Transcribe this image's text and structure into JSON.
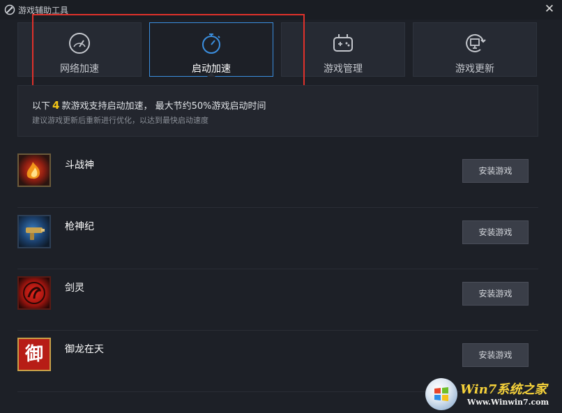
{
  "window": {
    "title": "游戏辅助工具",
    "close_glyph": "✕"
  },
  "tabs": [
    {
      "label": "网络加速",
      "icon": "speedometer-icon",
      "active": false
    },
    {
      "label": "启动加速",
      "icon": "stopwatch-icon",
      "active": true
    },
    {
      "label": "游戏管理",
      "icon": "gamepad-icon",
      "active": false
    },
    {
      "label": "游戏更新",
      "icon": "monitor-refresh-icon",
      "active": false
    }
  ],
  "info": {
    "prefix": "以下",
    "count": "4",
    "suffix": "款游戏支持启动加速， 最大节约50%游戏启动时间",
    "sub": "建议游戏更新后重新进行优化，以达到最快启动速度"
  },
  "games": [
    {
      "name": "斗战神",
      "button": "安装游戏",
      "icon": "douzhanshen-game-icon"
    },
    {
      "name": "枪神纪",
      "button": "安装游戏",
      "icon": "qiangshenji-game-icon"
    },
    {
      "name": "剑灵",
      "button": "安装游戏",
      "icon": "jianling-game-icon"
    },
    {
      "name": "御龙在天",
      "button": "安装游戏",
      "icon": "yulongzaitian-game-icon",
      "glyph": "御"
    }
  ],
  "watermark": {
    "title": "Win7系统之家",
    "url": "Www.Winwin7.com"
  },
  "colors": {
    "accent": "#3b8fe0",
    "highlight_box": "#e0312b",
    "count": "#f3c516",
    "background": "#1d2027"
  }
}
